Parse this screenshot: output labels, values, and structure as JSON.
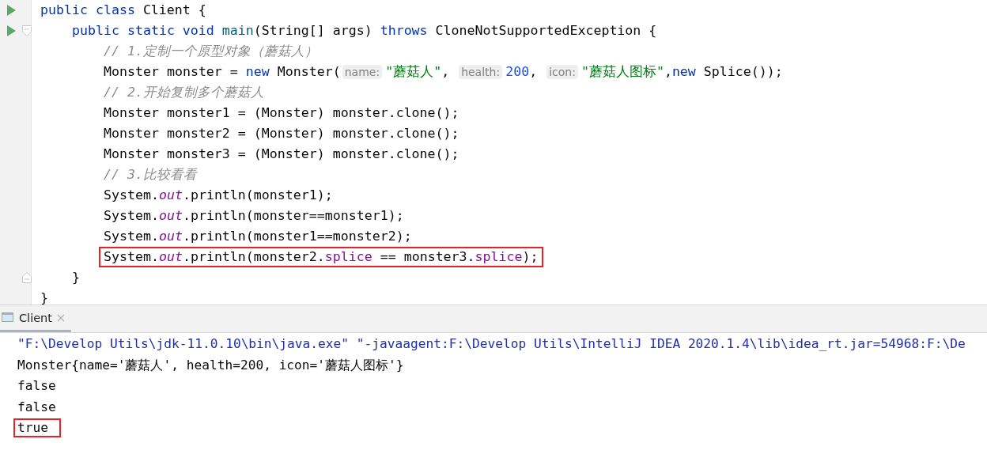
{
  "editor": {
    "lines": [
      {
        "run": true,
        "boxed": false,
        "tokens": [
          {
            "kind": "keyword",
            "text": "public class "
          },
          {
            "kind": "plain",
            "text": "Client {"
          }
        ],
        "children": [
          {
            "run": true,
            "fold_open": true,
            "boxed": false,
            "tokens": [
              {
                "kind": "keyword",
                "text": "public static void "
              },
              {
                "kind": "method",
                "text": "main"
              },
              {
                "kind": "plain",
                "text": "(String[] args) "
              },
              {
                "kind": "keyword",
                "text": "throws "
              },
              {
                "kind": "plain",
                "text": "CloneNotSupportedException {"
              }
            ],
            "children": [
              {
                "run": false,
                "boxed": false,
                "tokens": [
                  {
                    "kind": "comment",
                    "text": "// 1.定制一个原型对象（蘑菇人）"
                  }
                ]
              },
              {
                "run": false,
                "boxed": false,
                "tokens": [
                  {
                    "kind": "plain",
                    "text": "Monster monster = "
                  },
                  {
                    "kind": "keyword",
                    "text": "new "
                  },
                  {
                    "kind": "plain",
                    "text": "Monster("
                  },
                  {
                    "kind": "hint",
                    "text": "name:"
                  },
                  {
                    "kind": "string",
                    "text": "\"蘑菇人\""
                  },
                  {
                    "kind": "plain",
                    "text": ", "
                  },
                  {
                    "kind": "hint",
                    "text": "health:"
                  },
                  {
                    "kind": "number",
                    "text": "200"
                  },
                  {
                    "kind": "plain",
                    "text": ", "
                  },
                  {
                    "kind": "hint",
                    "text": "icon:"
                  },
                  {
                    "kind": "string",
                    "text": "\"蘑菇人图标\""
                  },
                  {
                    "kind": "plain",
                    "text": ","
                  },
                  {
                    "kind": "keyword",
                    "text": "new "
                  },
                  {
                    "kind": "plain",
                    "text": "Splice());"
                  }
                ]
              },
              {
                "run": false,
                "boxed": false,
                "tokens": [
                  {
                    "kind": "comment",
                    "text": "// 2.开始复制多个蘑菇人"
                  }
                ]
              },
              {
                "run": false,
                "boxed": false,
                "tokens": [
                  {
                    "kind": "plain",
                    "text": "Monster monster1 = (Monster) monster.clone();"
                  }
                ]
              },
              {
                "run": false,
                "boxed": false,
                "tokens": [
                  {
                    "kind": "plain",
                    "text": "Monster monster2 = (Monster) monster.clone();"
                  }
                ]
              },
              {
                "run": false,
                "boxed": false,
                "tokens": [
                  {
                    "kind": "plain",
                    "text": "Monster monster3 = (Monster) monster.clone();"
                  }
                ]
              },
              {
                "run": false,
                "boxed": false,
                "tokens": [
                  {
                    "kind": "comment",
                    "text": "// 3.比较看看"
                  }
                ]
              },
              {
                "run": false,
                "boxed": false,
                "tokens": [
                  {
                    "kind": "plain",
                    "text": "System."
                  },
                  {
                    "kind": "static",
                    "text": "out"
                  },
                  {
                    "kind": "plain",
                    "text": ".println(monster1);"
                  }
                ]
              },
              {
                "run": false,
                "boxed": false,
                "tokens": [
                  {
                    "kind": "plain",
                    "text": "System."
                  },
                  {
                    "kind": "static",
                    "text": "out"
                  },
                  {
                    "kind": "plain",
                    "text": ".println(monster==monster1);"
                  }
                ]
              },
              {
                "run": false,
                "boxed": false,
                "tokens": [
                  {
                    "kind": "plain",
                    "text": "System."
                  },
                  {
                    "kind": "static",
                    "text": "out"
                  },
                  {
                    "kind": "plain",
                    "text": ".println(monster1==monster2);"
                  }
                ]
              },
              {
                "run": false,
                "boxed": true,
                "tokens": [
                  {
                    "kind": "plain",
                    "text": "System."
                  },
                  {
                    "kind": "static",
                    "text": "out"
                  },
                  {
                    "kind": "plain",
                    "text": ".println(monster2."
                  },
                  {
                    "kind": "field",
                    "text": "splice"
                  },
                  {
                    "kind": "plain",
                    "text": " == monster3."
                  },
                  {
                    "kind": "field",
                    "text": "splice"
                  },
                  {
                    "kind": "plain",
                    "text": ");"
                  }
                ]
              }
            ]
          },
          {
            "run": false,
            "fold_close": true,
            "boxed": false,
            "tokens": [
              {
                "kind": "plain",
                "text": "}"
              }
            ]
          }
        ]
      },
      {
        "run": false,
        "boxed": false,
        "tokens": [
          {
            "kind": "plain",
            "text": "}"
          }
        ]
      }
    ]
  },
  "console": {
    "tabs": [
      {
        "label": "Client",
        "selected": true
      }
    ],
    "lines": [
      {
        "kind": "command",
        "boxed": false,
        "text": "\"F:\\Develop Utils\\jdk-11.0.10\\bin\\java.exe\" \"-javaagent:F:\\Develop Utils\\IntelliJ IDEA 2020.1.4\\lib\\idea_rt.jar=54968:F:\\De"
      },
      {
        "kind": "output",
        "boxed": false,
        "text": "Monster{name='蘑菇人', health=200, icon='蘑菇人图标'}"
      },
      {
        "kind": "output",
        "boxed": false,
        "text": "false"
      },
      {
        "kind": "output",
        "boxed": false,
        "text": "false"
      },
      {
        "kind": "output",
        "boxed": true,
        "text": "true"
      }
    ]
  }
}
